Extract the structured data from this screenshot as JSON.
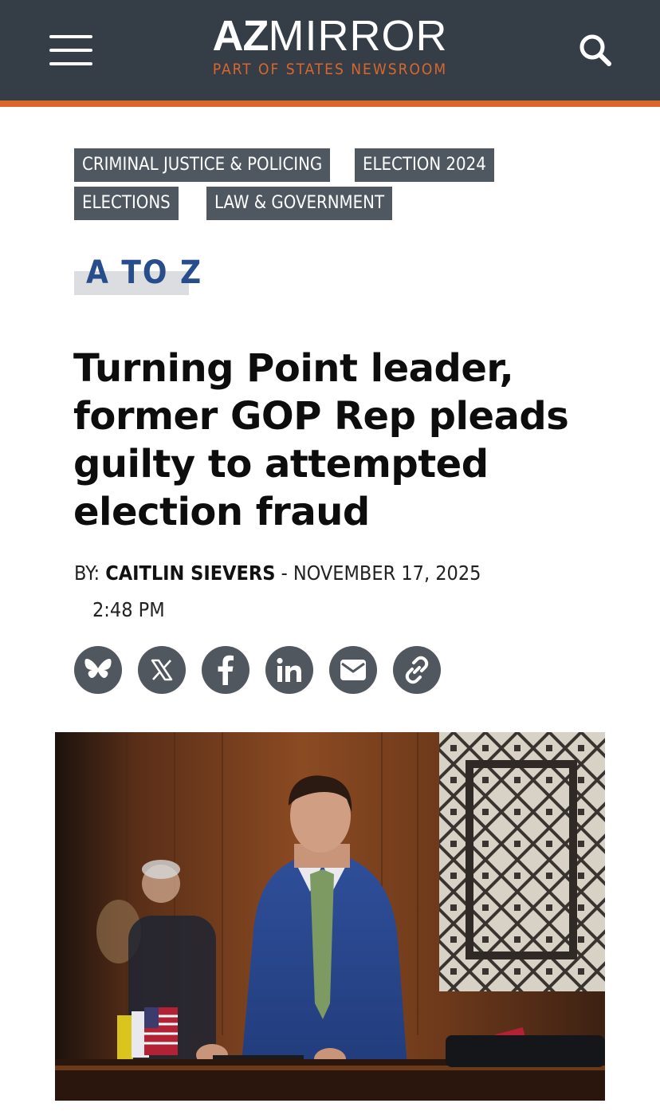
{
  "header": {
    "logo_bold": "AZ",
    "logo_light": "MIRROR",
    "logo_sub": "PART OF STATES NEWSROOM"
  },
  "colors": {
    "header_bg": "#353e47",
    "accent_orange": "#d9662b",
    "tag_bg": "#4f5861",
    "section_blue": "#274d8d"
  },
  "tags": [
    "CRIMINAL JUSTICE & POLICING",
    "ELECTION 2024",
    "ELECTIONS",
    "LAW & GOVERNMENT"
  ],
  "section": "A TO Z",
  "article": {
    "headline": "Turning Point leader, former GOP Rep pleads guilty to attempted election fraud",
    "by_label": "BY:",
    "author": "CAITLIN SIEVERS",
    "separator": "-",
    "date": "NOVEMBER 17, 2025",
    "time": "2:48 PM"
  },
  "share_icons": [
    "bluesky-icon",
    "x-icon",
    "facebook-icon",
    "linkedin-icon",
    "email-icon",
    "link-icon"
  ]
}
